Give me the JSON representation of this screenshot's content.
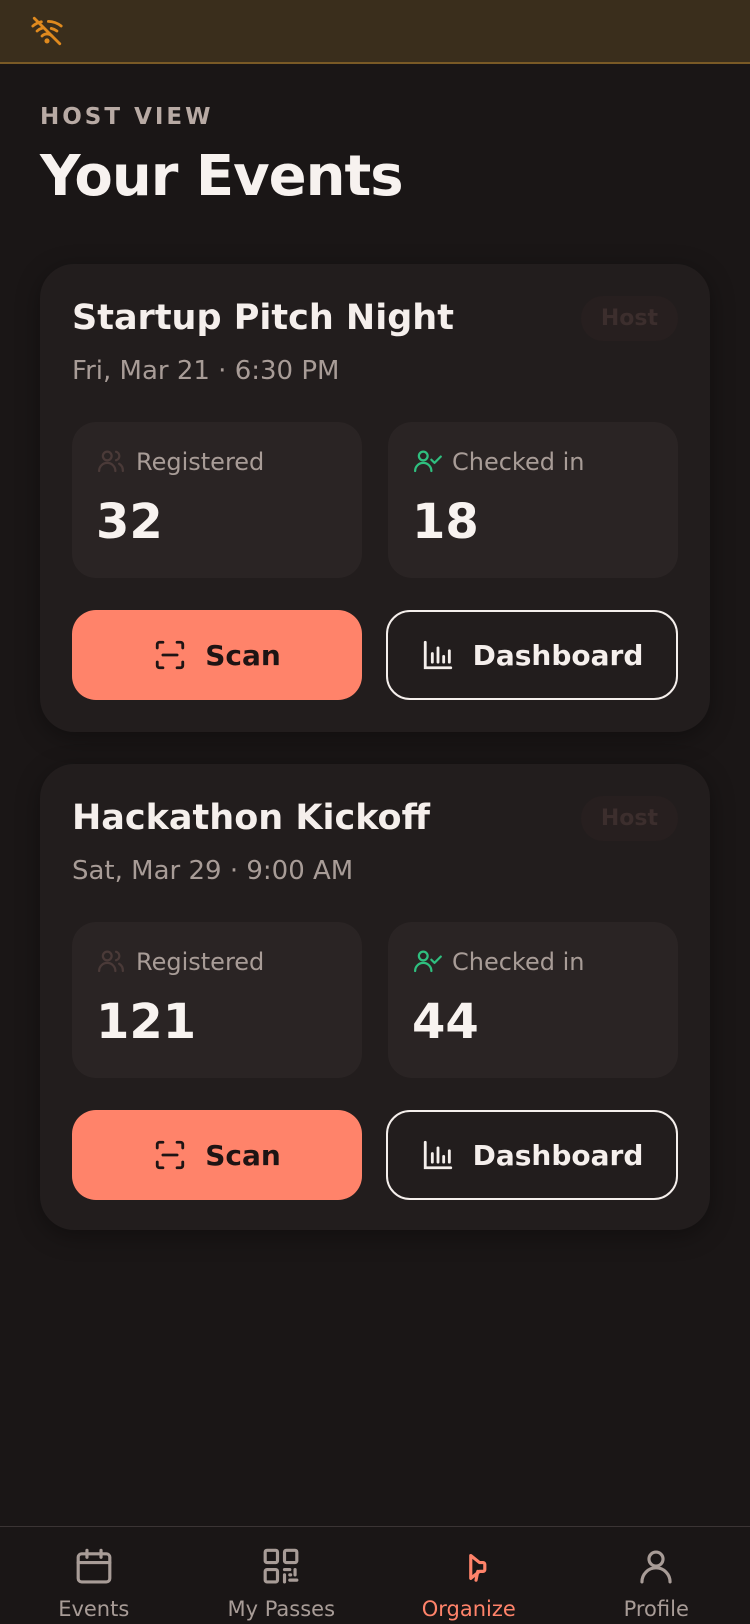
{
  "status_bar": {
    "icon": "wifi-off-icon"
  },
  "header": {
    "eyebrow": "HOST VIEW",
    "title": "Your Events"
  },
  "events": [
    {
      "name": "Startup Pitch Night",
      "date": "Fri, Mar 21 · 6:30 PM",
      "badge": "Host",
      "registered_label": "Registered",
      "registered": "32",
      "checked_label": "Checked in",
      "checked": "18",
      "scan_label": "Scan",
      "dashboard_label": "Dashboard"
    },
    {
      "name": "Hackathon Kickoff",
      "date": "Sat, Mar 29 · 9:00 AM",
      "badge": "Host",
      "registered_label": "Registered",
      "registered": "121",
      "checked_label": "Checked in",
      "checked": "44",
      "scan_label": "Scan",
      "dashboard_label": "Dashboard"
    }
  ],
  "nav": [
    {
      "label": "Events",
      "icon": "calendar-icon",
      "active": false
    },
    {
      "label": "My Passes",
      "icon": "qr-code-icon",
      "active": false
    },
    {
      "label": "Organize",
      "icon": "megaphone-icon",
      "active": true
    },
    {
      "label": "Profile",
      "icon": "user-icon",
      "active": false
    }
  ],
  "colors": {
    "accent": "#ff836a",
    "background": "#1a1616",
    "card": "#221d1d",
    "checked_green": "#2fbf7f",
    "status_bar": "#3a2e1c"
  }
}
